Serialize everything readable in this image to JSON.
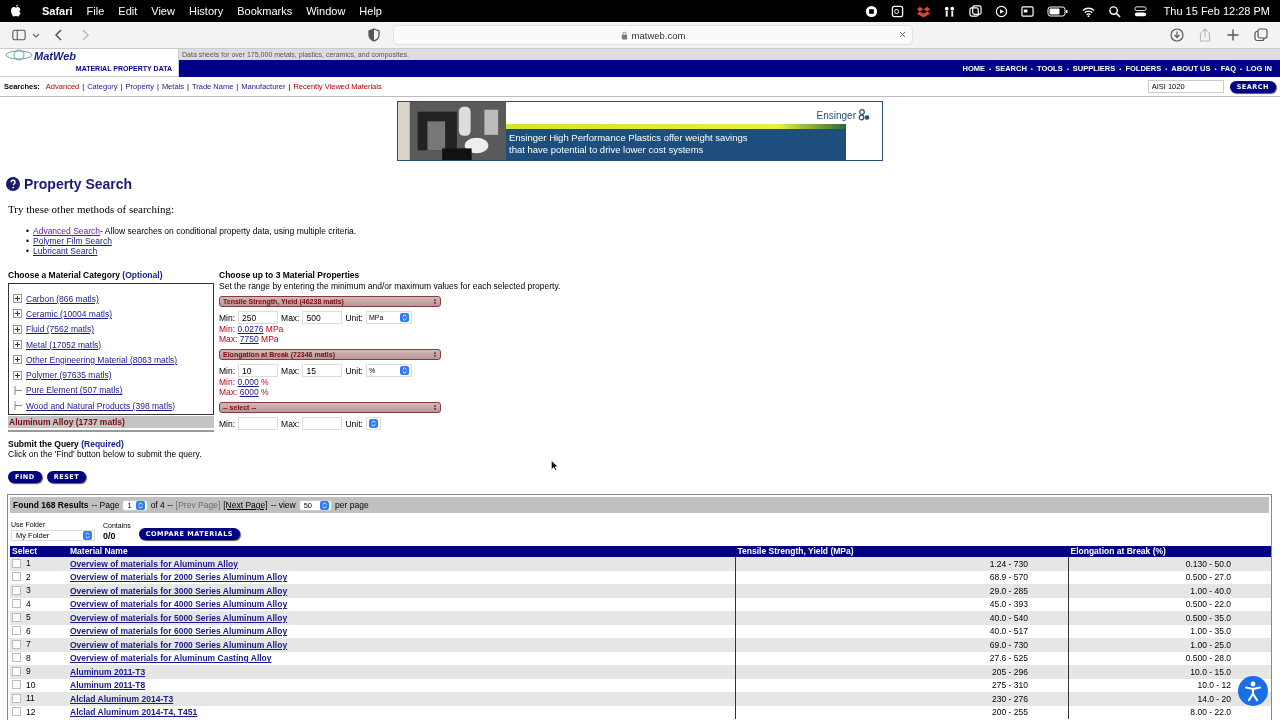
{
  "menubar": {
    "app": "Safari",
    "menus": [
      "File",
      "Edit",
      "View",
      "History",
      "Bookmarks",
      "Window",
      "Help"
    ],
    "clock": "Thu 15 Feb  12:28 PM"
  },
  "browser": {
    "url": "matweb.com"
  },
  "site": {
    "logo": "MatWeb",
    "logo_sub": "MATERIAL PROPERTY DATA",
    "tagline": "Data sheets for over 175,000 metals, plastics, ceramics, and composites.",
    "nav": [
      {
        "label": "HOME"
      },
      {
        "sep": "•",
        "label": "SEARCH"
      },
      {
        "sep": "•",
        "label": "TOOLS"
      },
      {
        "sep": "•",
        "label": "SUPPLIERS"
      },
      {
        "sep": "•",
        "label": "FOLDERS"
      },
      {
        "sep": "•",
        "label": "ABOUT US"
      },
      {
        "sep": "•",
        "label": "FAQ"
      },
      {
        "sep": "•",
        "label": "LOG IN"
      }
    ],
    "searches_label": "Searches:",
    "search_links": [
      {
        "label": "Advanced",
        "visited": true
      },
      {
        "sep": "|",
        "label": "Category",
        "visited": false
      },
      {
        "sep": "|",
        "label": "Property",
        "visited": false
      },
      {
        "sep": "|",
        "label": "Metals",
        "visited": false
      },
      {
        "sep": "|",
        "label": "Trade Name",
        "visited": false
      },
      {
        "sep": "|",
        "label": "Manufacturer",
        "visited": false
      },
      {
        "sep": "|",
        "label": "Recently Viewed Materials",
        "visited": true
      }
    ],
    "quick_search": {
      "value": "AISI 1020",
      "button": "SEARCH"
    }
  },
  "ad": {
    "brand": "Ensinger",
    "lines": [
      "Ensinger High Performance Plastics offer weight savings",
      "that have potential to drive lower cost systems"
    ]
  },
  "page": {
    "title": "Property Search",
    "intro": "Try these other methods of searching:",
    "methods": [
      {
        "marker": "•",
        "link": "Advanced Search",
        "visited": true,
        "description": "- Allow searches on conditional property data, using multiple criteria."
      },
      {
        "marker": "•",
        "link": "Polymer Film Search",
        "visited": false
      },
      {
        "marker": "•",
        "link": "Lubricant Search",
        "visited": false
      }
    ]
  },
  "category": {
    "heading": "Choose a Material Category",
    "note": "(Optional)",
    "items": [
      {
        "label": "Carbon (866 matls)",
        "expandable": true
      },
      {
        "label": "Ceramic (10004 matls)",
        "expandable": true
      },
      {
        "label": "Fluid (7562 matls)",
        "expandable": true
      },
      {
        "label": "Metal (17052 matls)",
        "expandable": true
      },
      {
        "label": "Other Engineering Material (8063 matls)",
        "expandable": true
      },
      {
        "label": "Polymer (97635 matls)",
        "expandable": true
      },
      {
        "label": "Pure Element (507 matls)",
        "expandable": false
      },
      {
        "label": "Wood and Natural Products (398 matls)",
        "expandable": false
      }
    ],
    "selected": "Aluminum Alloy (1737 matls)"
  },
  "submit": {
    "heading": "Submit the Query",
    "note": "(Required)",
    "text": "Click on the 'Find' button below to submit the query.",
    "buttons": [
      "FIND",
      "RESET"
    ]
  },
  "properties": {
    "heading": "Choose up to 3 Material Properties",
    "instruction": "Set the range by entering the minimum and/or maximum values for each selected property.",
    "rows": [
      {
        "select": "Tensile Strength, Yield (46238 matls)",
        "min_label": "Min:",
        "min": "250",
        "max_label": "Max:",
        "max": "500",
        "unit_label": "Unit:",
        "unit": "MPa",
        "range_min_label": "Min:",
        "range_min": "0.0276",
        "range_max_label": "Max:",
        "range_max": "7750",
        "range_min_unit": "MPa",
        "range_max_unit": "MPa"
      },
      {
        "select": "Elongation at Break (72346 matls)",
        "min_label": "Min:",
        "min": "10",
        "max_label": "Max:",
        "max": "15",
        "unit_label": "Unit:",
        "unit": "%",
        "range_min_label": "Min:",
        "range_min": "0.000",
        "range_max_label": "Max:",
        "range_max": "6000",
        "range_min_unit": "%",
        "range_max_unit": "%"
      },
      {
        "select": "-- select --",
        "min_label": "Min:",
        "max_label": "Max:",
        "unit_label": "Unit:"
      }
    ]
  },
  "results": {
    "found": "Found 168 Results",
    "page_label": "-- Page",
    "page": "1",
    "of": "of 4 --",
    "prev": {
      "label": "[Prev Page]",
      "disabled": true
    },
    "next": {
      "label": "[Next Page]",
      "disabled": false
    },
    "view_label": "-- view",
    "per_page": "50",
    "per_page_label": "per page",
    "folder_label": "Use Folder",
    "folder": "My Folder",
    "contains_label": "Contains",
    "contains": "0/0",
    "compare": "COMPARE MATERIALS",
    "columns": [
      "Select",
      "Material Name",
      "Tensile Strength, Yield (MPa)",
      "Elongation at Break (%)"
    ],
    "rows": [
      {
        "n": "1",
        "name": "Overview of materials for Aluminum Alloy",
        "tensile": "1.24 - 730",
        "elongation": "0.130 - 50.0",
        "checked": false
      },
      {
        "n": "2",
        "name": "Overview of materials for 2000 Series Aluminum Alloy",
        "tensile": "68.9 - 570",
        "elongation": "0.500 - 27.0",
        "checked": false
      },
      {
        "n": "3",
        "name": "Overview of materials for 3000 Series Aluminum Alloy",
        "tensile": "29.0 - 285",
        "elongation": "1.00 - 40.0",
        "checked": false
      },
      {
        "n": "4",
        "name": "Overview of materials for 4000 Series Aluminum Alloy",
        "tensile": "45.0 - 393",
        "elongation": "0.500 - 22.0",
        "checked": false
      },
      {
        "n": "5",
        "name": "Overview of materials for 5000 Series Aluminum Alloy",
        "tensile": "40.0 - 540",
        "elongation": "0.500 - 35.0",
        "checked": false
      },
      {
        "n": "6",
        "name": "Overview of materials for 6000 Series Aluminum Alloy",
        "tensile": "40.0 - 517",
        "elongation": "1.00 - 35.0",
        "checked": false
      },
      {
        "n": "7",
        "name": "Overview of materials for 7000 Series Aluminum Alloy",
        "tensile": "69.0 - 730",
        "elongation": "1.00 - 25.0",
        "checked": false
      },
      {
        "n": "8",
        "name": "Overview of materials for Aluminum Casting Alloy",
        "tensile": "27.6 - 525",
        "elongation": "0.500 - 28.0",
        "checked": false
      },
      {
        "n": "9",
        "name": "Aluminum 2011-T3",
        "tensile": "205 - 296",
        "elongation": "10.0 - 15.0",
        "checked": false
      },
      {
        "n": "10",
        "name": "Aluminum 2011-T8",
        "tensile": "275 - 310",
        "elongation": "10.0 - 12",
        "checked": false
      },
      {
        "n": "11",
        "name": "Alclad Aluminum 2014-T3",
        "tensile": "230 - 276",
        "elongation": "14.0 - 20",
        "checked": false
      },
      {
        "n": "12",
        "name": "Alclad Aluminum 2014-T4, T451",
        "tensile": "200 - 255",
        "elongation": "8.00 - 22.0",
        "checked": false
      }
    ]
  }
}
